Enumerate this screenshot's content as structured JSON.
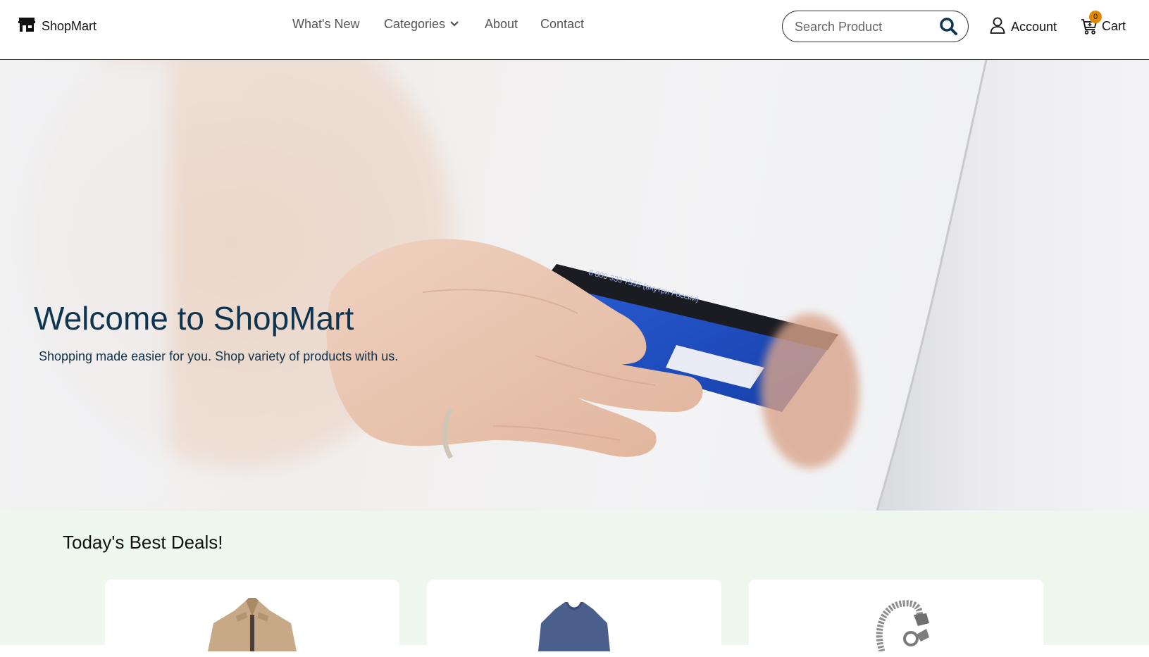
{
  "brand": {
    "name": "ShopMart",
    "icon": "store-icon"
  },
  "nav": {
    "items": [
      {
        "label": "What's New",
        "icon": null
      },
      {
        "label": "Categories",
        "icon": "chevron-down-icon"
      },
      {
        "label": "About",
        "icon": null
      },
      {
        "label": "Contact",
        "icon": null
      }
    ]
  },
  "search": {
    "placeholder": "Search Product",
    "value": "",
    "icon": "search-icon"
  },
  "account": {
    "label": "Account",
    "icon": "user-icon"
  },
  "cart": {
    "label": "Cart",
    "count": "0",
    "icon": "cart-icon"
  },
  "hero": {
    "title": "Welcome to ShopMart",
    "subtitle": "Shopping made easier for you. Shop variety of products with us.",
    "card_text": "8 800 333 7555 (внутри России)"
  },
  "deals": {
    "title": "Today's Best Deals!",
    "products": [
      {
        "image": "jacket-image"
      },
      {
        "image": "sweater-image"
      },
      {
        "image": "bracelet-image"
      }
    ]
  },
  "colors": {
    "hero_title": "#0d3550",
    "deals_background": "#eef8ee",
    "cart_badge": "#e08a00",
    "card_blue": "#1d4fc4"
  }
}
